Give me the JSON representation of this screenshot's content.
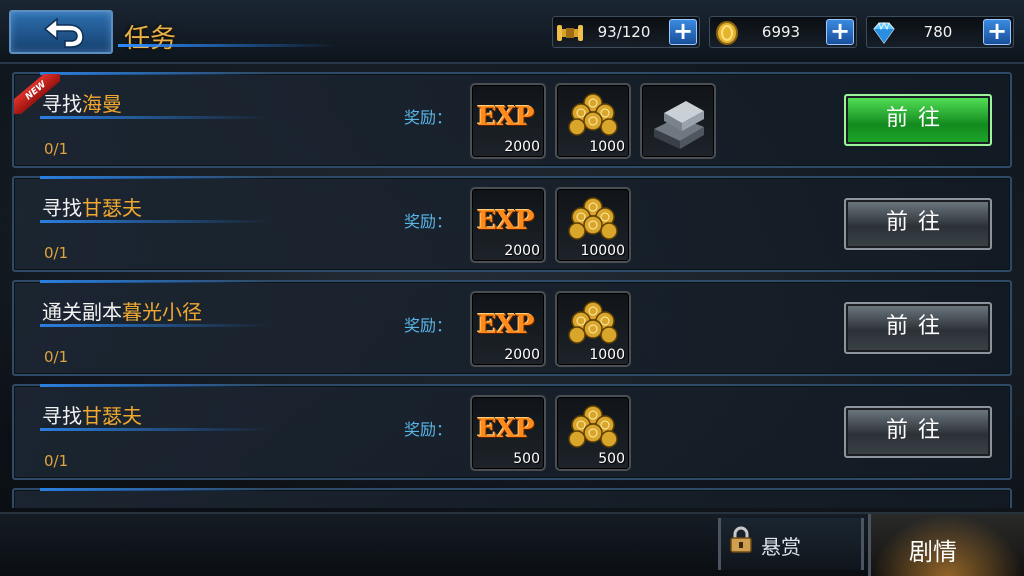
{
  "header": {
    "title": "任务",
    "resources": [
      {
        "icon": "stamina-icon",
        "value": "93/120"
      },
      {
        "icon": "gold-coin-icon",
        "value": "6993"
      },
      {
        "icon": "diamond-icon",
        "value": "780"
      }
    ],
    "plus_label": "+"
  },
  "quests": [
    {
      "name_prefix": "寻找",
      "name_highlight": "海曼",
      "progress": "0/1",
      "reward_label": "奖励：",
      "is_new": true,
      "new_label": "NEW",
      "rewards": [
        {
          "type": "exp",
          "label": "EXP",
          "count": "2000"
        },
        {
          "type": "gold",
          "count": "1000"
        },
        {
          "type": "iron-ingot",
          "count": ""
        }
      ],
      "button_label": "前往",
      "button_active": true
    },
    {
      "name_prefix": "寻找",
      "name_highlight": "甘瑟夫",
      "progress": "0/1",
      "reward_label": "奖励：",
      "rewards": [
        {
          "type": "exp",
          "label": "EXP",
          "count": "2000"
        },
        {
          "type": "gold",
          "count": "10000"
        }
      ],
      "button_label": "前往",
      "button_active": false
    },
    {
      "name_prefix": "通关副本",
      "name_highlight": "暮光小径",
      "progress": "0/1",
      "reward_label": "奖励：",
      "rewards": [
        {
          "type": "exp",
          "label": "EXP",
          "count": "2000"
        },
        {
          "type": "gold",
          "count": "1000"
        }
      ],
      "button_label": "前往",
      "button_active": false
    },
    {
      "name_prefix": "寻找",
      "name_highlight": "甘瑟夫",
      "progress": "0/1",
      "reward_label": "奖励：",
      "rewards": [
        {
          "type": "exp",
          "label": "EXP",
          "count": "500"
        },
        {
          "type": "gold",
          "count": "500"
        }
      ],
      "button_label": "前往",
      "button_active": false
    }
  ],
  "bottom_tabs": {
    "bounty": {
      "label": "悬赏",
      "locked": true
    },
    "story": {
      "label": "剧情",
      "selected": true
    }
  },
  "colors": {
    "quest_highlight": "#f0a830",
    "reward_label": "#58b6e6",
    "active_button": "#2fbf3a"
  }
}
